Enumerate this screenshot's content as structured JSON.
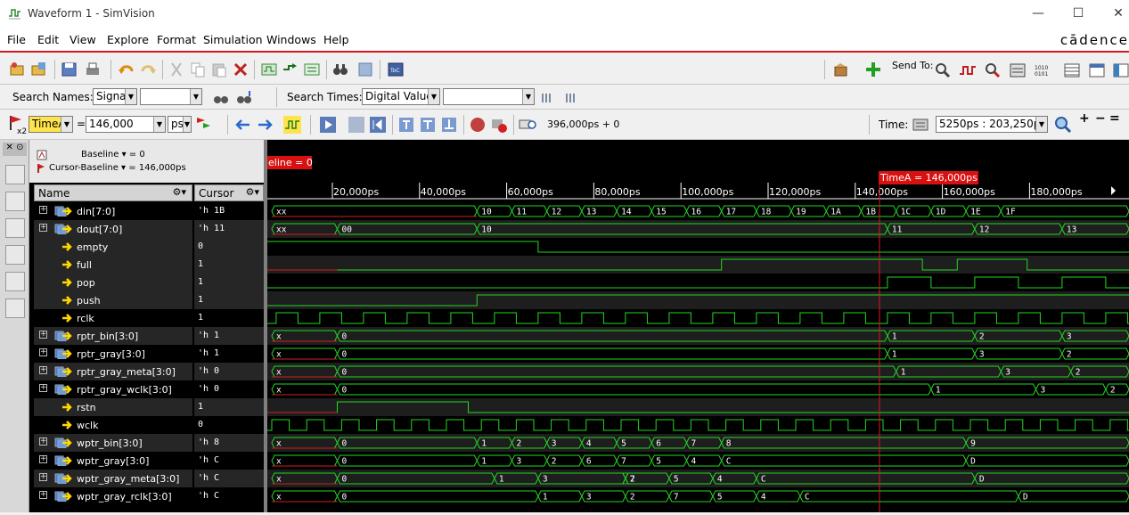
{
  "window": {
    "title": "Waveform 1 - SimVision",
    "controls": [
      "—",
      "☐",
      "✕"
    ]
  },
  "menu": [
    "File",
    "Edit",
    "View",
    "Explore",
    "Format",
    "Simulation",
    "Windows",
    "Help"
  ],
  "brand": "cādence",
  "search": {
    "names_label": "Search Names:",
    "names_type": "Signal",
    "times_label": "Search Times:",
    "times_type": "Digital Value"
  },
  "cursorbar": {
    "cursor_name": "TimeA",
    "equals": "=",
    "cursor_value": "146,000",
    "unit": "ps",
    "x2": "x2",
    "runtime": "396,000ps + 0",
    "time_label": "Time:",
    "time_range": "5250ps : 203,250p"
  },
  "sendto": "Send To:",
  "baseline": {
    "baseline_text": "Baseline ▾ = 0",
    "cursor_baseline_text": "Cursor-Baseline ▾ = 146,000ps"
  },
  "columns": {
    "name": "Name",
    "cursor": "Cursor"
  },
  "marker": {
    "baseline_tag": "eline = 0",
    "timea_tag": "TimeA = 146,000ps"
  },
  "timescale": [
    "20,000ps",
    "40,000ps",
    "60,000ps",
    "80,000ps",
    "100,000ps",
    "120,000ps",
    "140,000ps",
    "160,000ps",
    "180,000ps"
  ],
  "signals": [
    {
      "name": "din[7:0]",
      "value": "'h 1B",
      "bus": true
    },
    {
      "name": "dout[7:0]",
      "value": "'h 11",
      "bus": true
    },
    {
      "name": "empty",
      "value": "0",
      "bus": false
    },
    {
      "name": "full",
      "value": "1",
      "bus": false
    },
    {
      "name": "pop",
      "value": "1",
      "bus": false
    },
    {
      "name": "push",
      "value": "1",
      "bus": false
    },
    {
      "name": "rclk",
      "value": "1",
      "bus": false
    },
    {
      "name": "rptr_bin[3:0]",
      "value": "'h 1",
      "bus": true
    },
    {
      "name": "rptr_gray[3:0]",
      "value": "'h 1",
      "bus": true
    },
    {
      "name": "rptr_gray_meta[3:0]",
      "value": "'h 0",
      "bus": true
    },
    {
      "name": "rptr_gray_wclk[3:0]",
      "value": "'h 0",
      "bus": true
    },
    {
      "name": "rstn",
      "value": "1",
      "bus": false
    },
    {
      "name": "wclk",
      "value": "0",
      "bus": false
    },
    {
      "name": "wptr_bin[3:0]",
      "value": "'h 8",
      "bus": true
    },
    {
      "name": "wptr_gray[3:0]",
      "value": "'h C",
      "bus": true
    },
    {
      "name": "wptr_gray_meta[3:0]",
      "value": "'h C",
      "bus": true
    },
    {
      "name": "wptr_gray_rclk[3:0]",
      "value": "'h C",
      "bus": true
    }
  ],
  "bus_segments": [
    [
      [
        "xx",
        0
      ],
      [
        "10",
        47
      ],
      [
        "11",
        55
      ],
      [
        "12",
        63
      ],
      [
        "13",
        71
      ],
      [
        "14",
        79
      ],
      [
        "15",
        87
      ],
      [
        "16",
        95
      ],
      [
        "17",
        103
      ],
      [
        "18",
        111
      ],
      [
        "19",
        119
      ],
      [
        "1A",
        127
      ],
      [
        "1B",
        135
      ],
      [
        "1C",
        143
      ],
      [
        "1D",
        151
      ],
      [
        "1E",
        159
      ],
      [
        "1F",
        167
      ]
    ],
    [
      [
        "xx",
        0
      ],
      [
        "00",
        15
      ],
      [
        "10",
        47
      ],
      [
        "11",
        141
      ],
      [
        "12",
        161
      ],
      [
        "13",
        181
      ]
    ],
    null,
    null,
    null,
    null,
    null,
    [
      [
        "x",
        0
      ],
      [
        "0",
        15
      ],
      [
        "1",
        141
      ],
      [
        "2",
        161
      ],
      [
        "3",
        181
      ]
    ],
    [
      [
        "x",
        0
      ],
      [
        "0",
        15
      ],
      [
        "1",
        141
      ],
      [
        "3",
        161
      ],
      [
        "2",
        181
      ]
    ],
    [
      [
        "x",
        0
      ],
      [
        "0",
        15
      ],
      [
        "1",
        143
      ],
      [
        "3",
        167
      ],
      [
        "2",
        183
      ]
    ],
    [
      [
        "x",
        0
      ],
      [
        "0",
        15
      ],
      [
        "1",
        151
      ],
      [
        "3",
        175
      ],
      [
        "2",
        191
      ]
    ],
    null,
    null,
    [
      [
        "x",
        0
      ],
      [
        "0",
        15
      ],
      [
        "1",
        47
      ],
      [
        "2",
        55
      ],
      [
        "3",
        63
      ],
      [
        "4",
        71
      ],
      [
        "5",
        79
      ],
      [
        "6",
        87
      ],
      [
        "7",
        95
      ],
      [
        "8",
        103
      ],
      [
        "9",
        159
      ]
    ],
    [
      [
        "x",
        0
      ],
      [
        "0",
        15
      ],
      [
        "1",
        47
      ],
      [
        "3",
        55
      ],
      [
        "2",
        63
      ],
      [
        "6",
        71
      ],
      [
        "7",
        79
      ],
      [
        "5",
        87
      ],
      [
        "4",
        95
      ],
      [
        "C",
        103
      ],
      [
        "D",
        159
      ]
    ],
    [
      [
        "x",
        0
      ],
      [
        "0",
        15
      ],
      [
        "1",
        51
      ],
      [
        "3",
        61
      ],
      [
        "2",
        81
      ],
      [
        "7",
        81
      ],
      [
        "5",
        91
      ],
      [
        "4",
        101
      ],
      [
        "C",
        111
      ],
      [
        "D",
        161
      ]
    ],
    [
      [
        "x",
        0
      ],
      [
        "0",
        15
      ],
      [
        "1",
        61
      ],
      [
        "3",
        71
      ],
      [
        "2",
        81
      ],
      [
        "7",
        91
      ],
      [
        "5",
        101
      ],
      [
        "4",
        111
      ],
      [
        "C",
        121
      ],
      [
        "D",
        171
      ]
    ]
  ]
}
